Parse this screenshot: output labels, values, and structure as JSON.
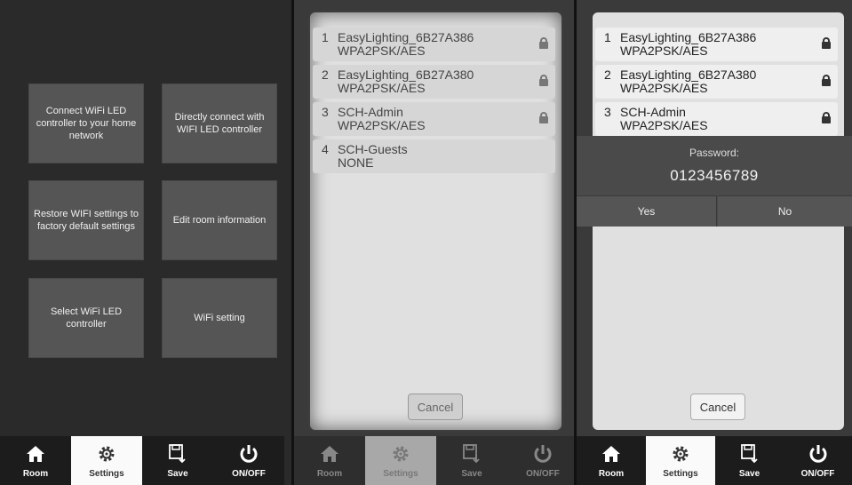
{
  "settings_menu": {
    "tiles": [
      "Connect WiFi LED controller to your home network",
      "Directly connect with WIFI LED controller",
      "Restore WIFI settings to factory default settings",
      "Edit room information",
      "Select WiFi LED controller",
      "WiFi setting"
    ]
  },
  "wifi_list": {
    "networks": [
      {
        "num": "1",
        "ssid": "EasyLighting_6B27A386",
        "security": "WPA2PSK/AES",
        "locked": true
      },
      {
        "num": "2",
        "ssid": "EasyLighting_6B27A380",
        "security": "WPA2PSK/AES",
        "locked": true
      },
      {
        "num": "3",
        "ssid": "SCH-Admin",
        "security": "WPA2PSK/AES",
        "locked": true
      },
      {
        "num": "4",
        "ssid": "SCH-Guests",
        "security": "NONE",
        "locked": false
      }
    ],
    "cancel_label": "Cancel"
  },
  "password_dialog": {
    "label": "Password:",
    "value": "0123456789",
    "yes_label": "Yes",
    "no_label": "No"
  },
  "tabbar": {
    "room": "Room",
    "settings": "Settings",
    "save": "Save",
    "onoff": "ON/OFF"
  }
}
